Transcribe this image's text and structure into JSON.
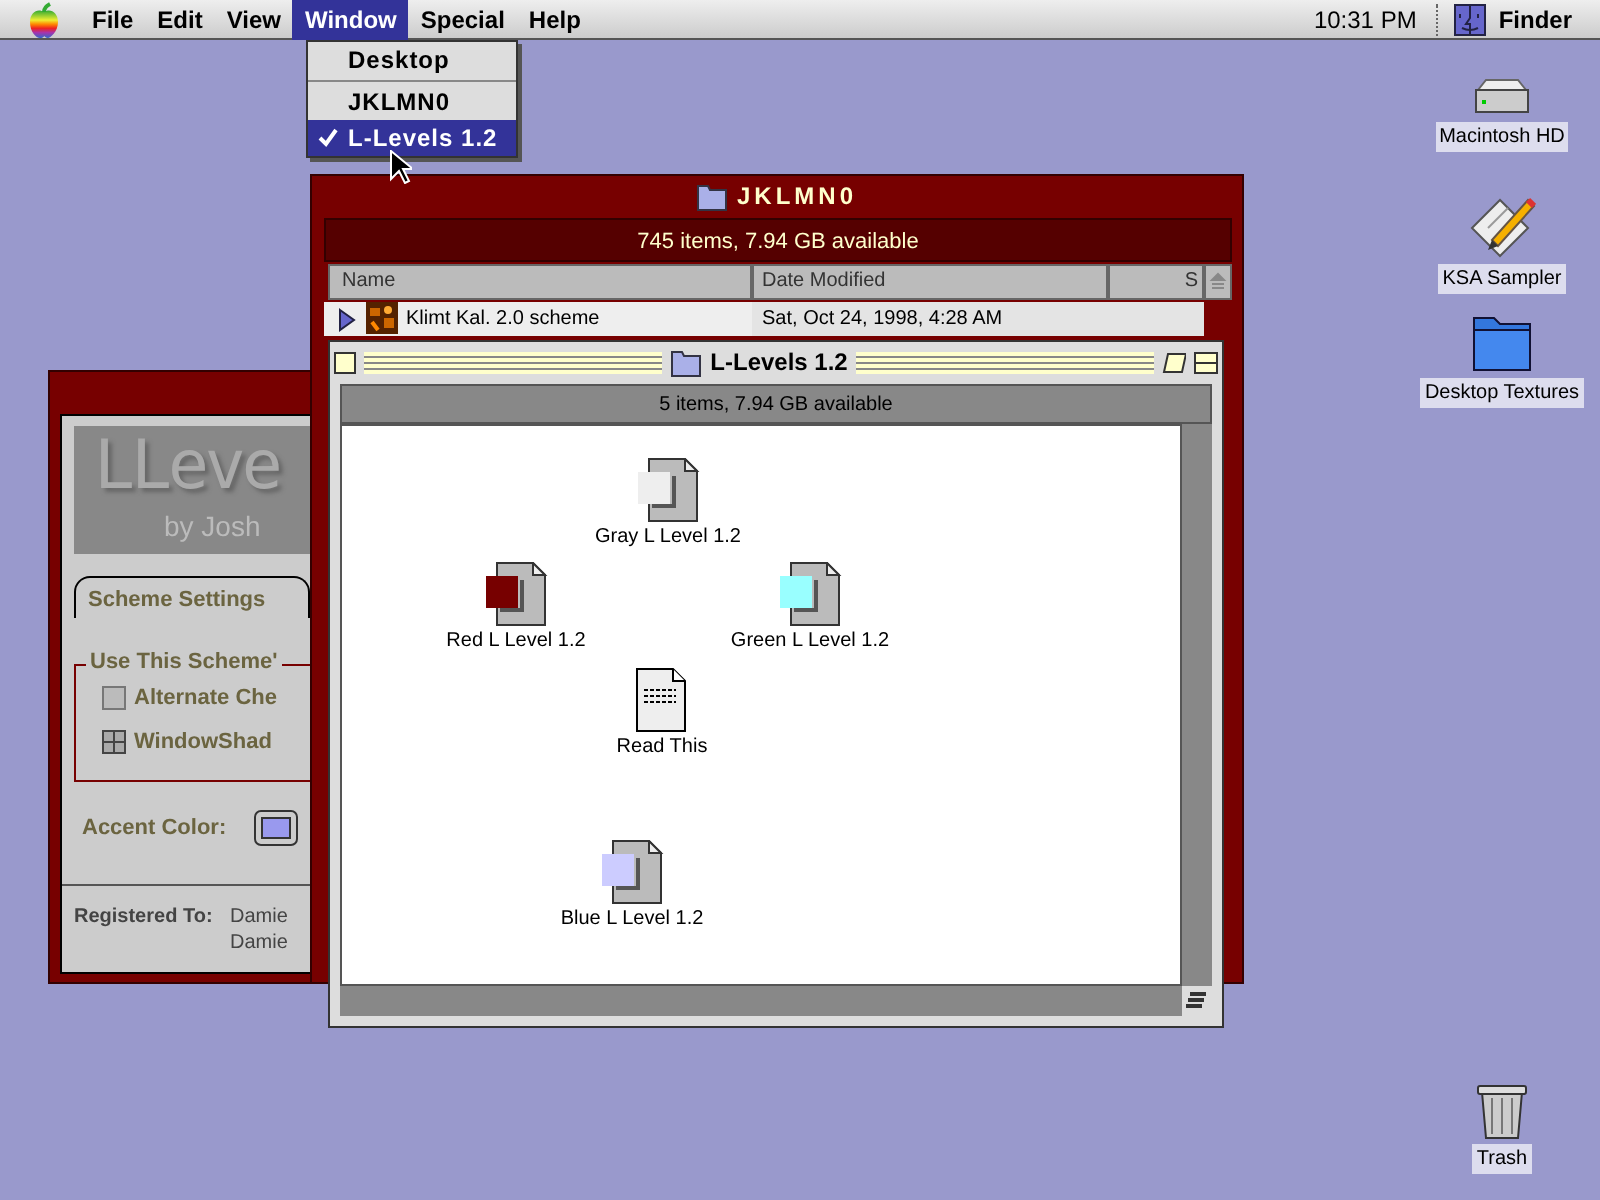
{
  "menu_bar": {
    "menus": [
      {
        "label": "File",
        "selected": false
      },
      {
        "label": "Edit",
        "selected": false
      },
      {
        "label": "View",
        "selected": false
      },
      {
        "label": "Window",
        "selected": true
      },
      {
        "label": "Special",
        "selected": false
      },
      {
        "label": "Help",
        "selected": false
      }
    ],
    "clock": "10:31 PM",
    "app": "Finder"
  },
  "window_menu": {
    "items": [
      {
        "label": "Desktop",
        "checked": false,
        "selected": false
      },
      {
        "label": "JKLMN0",
        "checked": false,
        "selected": false
      },
      {
        "label": "L-Levels 1.2",
        "checked": true,
        "selected": true
      }
    ]
  },
  "desktop_icons": [
    {
      "label": "Macintosh HD",
      "kind": "drive"
    },
    {
      "label": "KSA Sampler",
      "kind": "app"
    },
    {
      "label": "Desktop Textures",
      "kind": "folder"
    },
    {
      "label": "Trash",
      "kind": "trash"
    }
  ],
  "settings_window": {
    "logo": "LLeve",
    "byline": "by Josh",
    "tab": "Scheme Settings",
    "group": "Use This Scheme'",
    "options": [
      {
        "label": "Alternate Che",
        "kind": "checkbox",
        "checked": false
      },
      {
        "label": "WindowShad",
        "kind": "mixed",
        "checked": false
      }
    ],
    "accent_label": "Accent Color:",
    "registered_label": "Registered To:",
    "registered_lines": [
      "Damie",
      "Damie"
    ]
  },
  "list_window": {
    "title": "JKLMN0",
    "status": "745 items, 7.94 GB available",
    "columns": [
      "Name",
      "Date Modified",
      "S"
    ],
    "rows": [
      {
        "name": "Klimt Kal. 2.0 scheme",
        "date": "Sat, Oct 24, 1998, 4:28 AM",
        "expanded": false
      }
    ]
  },
  "icon_window": {
    "title": "L-Levels 1.2",
    "status": "5 items, 7.94 GB available",
    "files": [
      {
        "label": "Gray L Level 1.2",
        "kind": "swatch",
        "color": "#eeeeee"
      },
      {
        "label": "Red L Level 1.2",
        "kind": "swatch",
        "color": "#770000"
      },
      {
        "label": "Green L Level 1.2",
        "kind": "swatch",
        "color": "#99ffff"
      },
      {
        "label": "Read This",
        "kind": "text"
      },
      {
        "label": "Blue L Level 1.2",
        "kind": "swatch",
        "color": "#ccccff"
      }
    ]
  }
}
